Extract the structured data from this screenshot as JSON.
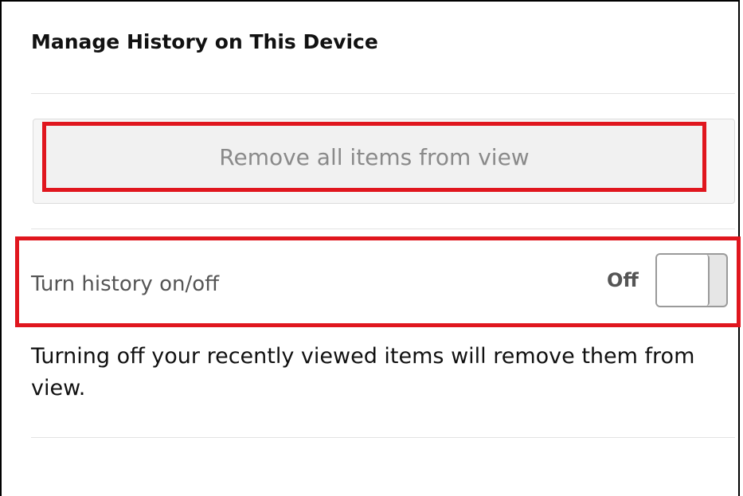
{
  "section": {
    "title": "Manage History on This Device"
  },
  "remove": {
    "label": "Remove all items from view"
  },
  "history_toggle": {
    "label": "Turn history on/off",
    "state_text": "Off",
    "is_on": false
  },
  "description": "Turning off your recently viewed items will remove them from view.",
  "colors": {
    "highlight_border": "#e0161e",
    "muted_text": "#8a8a8a",
    "divider": "#e3e3e3"
  }
}
